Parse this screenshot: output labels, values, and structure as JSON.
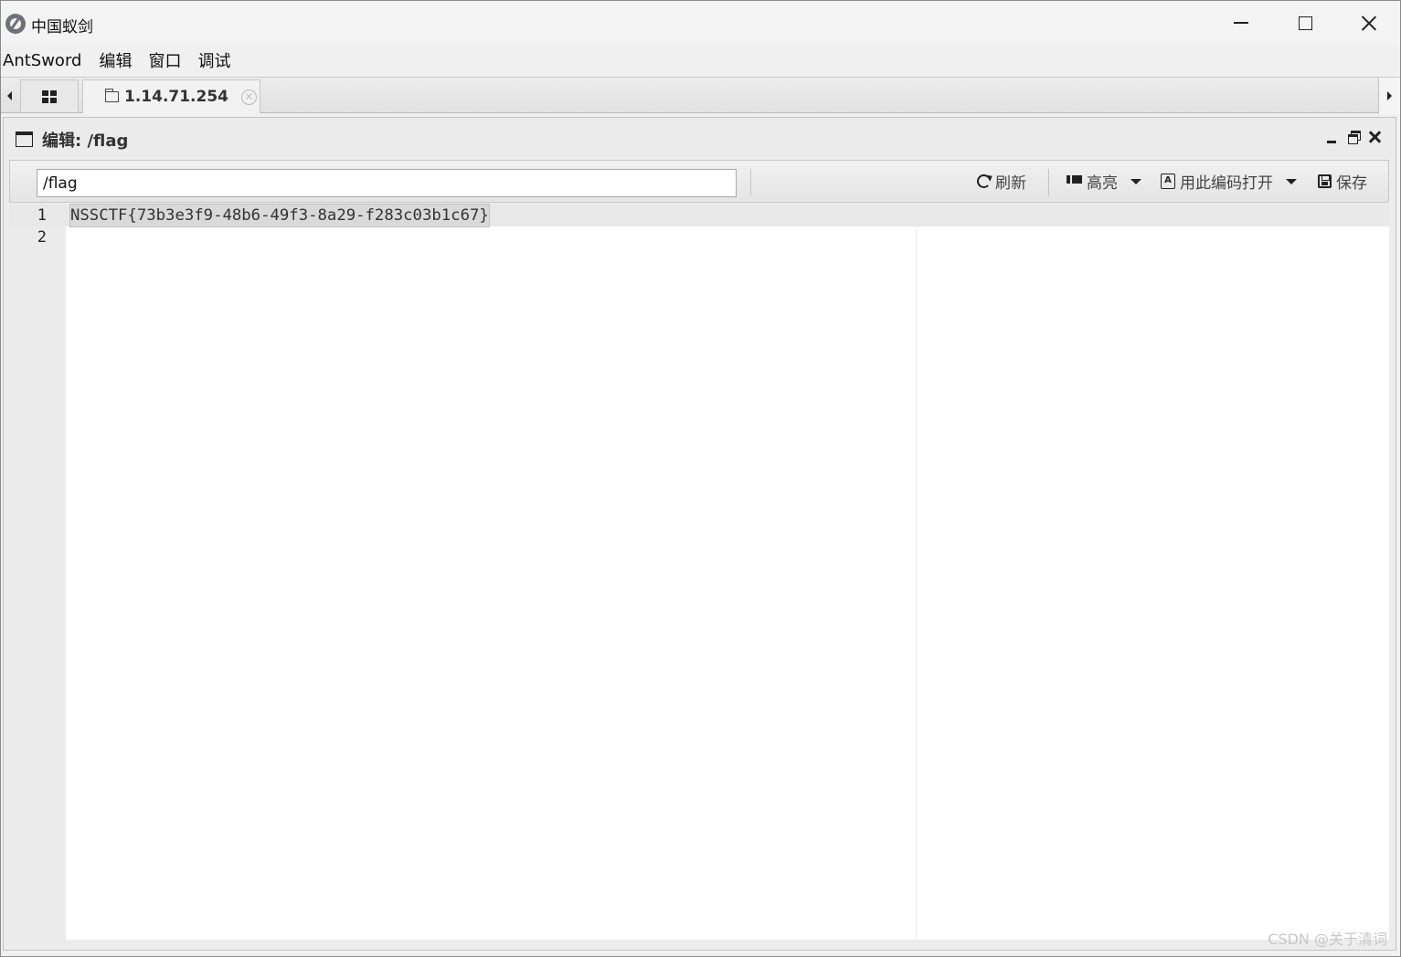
{
  "app": {
    "title": "中国蚁剑",
    "icon": "antsword-logo-icon"
  },
  "menu": {
    "items": [
      "AntSword",
      "编辑",
      "窗口",
      "调试"
    ]
  },
  "tabs": {
    "home_icon": "grid-icon",
    "items": [
      {
        "label": "1.14.71.254",
        "icon": "folder-icon",
        "closable": true
      }
    ]
  },
  "panel": {
    "title": "编辑: /flag",
    "icon": "window-icon"
  },
  "toolbar": {
    "path_value": "/flag",
    "refresh_label": "刷新",
    "highlight_label": "高亮",
    "encoding_label": "用此编码打开",
    "save_label": "保存"
  },
  "editor": {
    "lines": [
      {
        "number": "1",
        "text": "NSSCTF{73b3e3f9-48b6-49f3-8a29-f283c03b1c67}"
      },
      {
        "number": "2",
        "text": ""
      }
    ]
  },
  "watermark": "CSDN @关于清词"
}
